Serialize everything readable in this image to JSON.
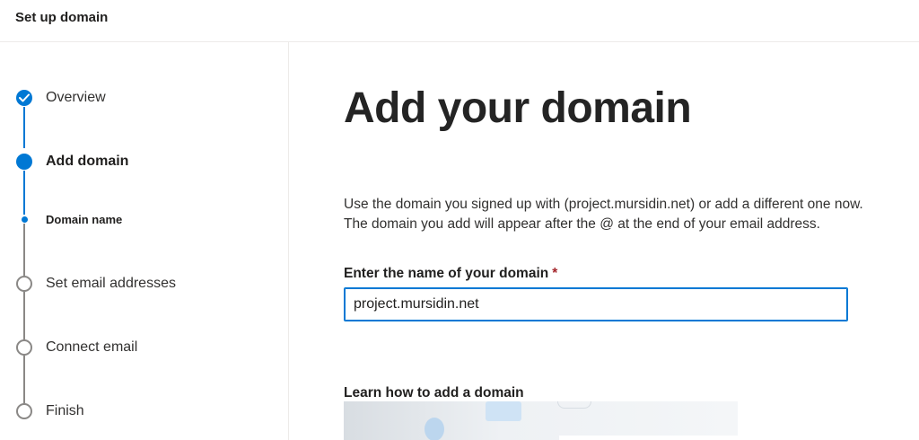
{
  "header": {
    "title": "Set up domain"
  },
  "sidebar": {
    "steps": [
      {
        "label": "Overview",
        "state": "done"
      },
      {
        "label": "Add domain",
        "state": "current"
      },
      {
        "label": "Domain name",
        "state": "current-substep"
      },
      {
        "label": "Set email addresses",
        "state": "todo"
      },
      {
        "label": "Connect email",
        "state": "todo"
      },
      {
        "label": "Finish",
        "state": "todo"
      }
    ]
  },
  "main": {
    "heading": "Add your domain",
    "description_line1": "Use the domain you signed up with (project.mursidin.net) or add a different one now.",
    "description_line2": "The domain you add will appear after the @ at the end of your email address.",
    "field_label": "Enter the name of your domain",
    "required_marker": "*",
    "domain_value": "project.mursidin.net",
    "learn_heading": "Learn how to add a domain"
  },
  "colors": {
    "accent": "#0078d4",
    "required": "#a4262c",
    "inactive": "#8a8886"
  },
  "icons": {
    "done_step": "checkmark-icon"
  }
}
